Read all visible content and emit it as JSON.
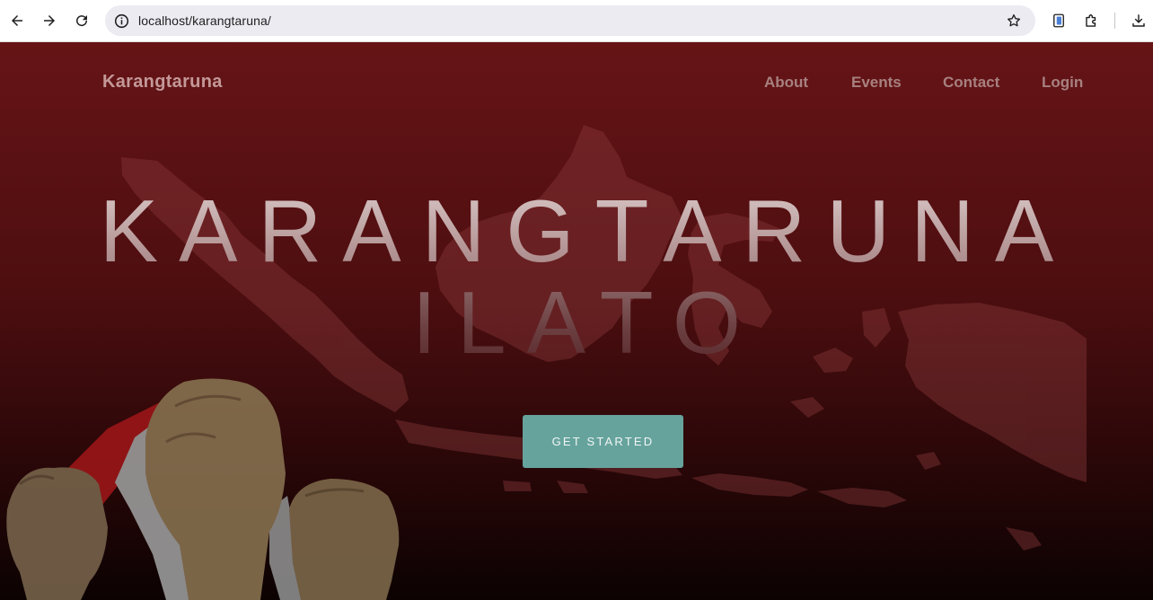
{
  "browser": {
    "url": "localhost/karangtaruna/",
    "icons": [
      "back-arrow-icon",
      "forward-arrow-icon",
      "reload-icon",
      "site-info-icon",
      "bookmark-star-icon",
      "tab-search-icon",
      "extensions-puzzle-icon",
      "download-icon"
    ]
  },
  "site": {
    "brand": "Karangtaruna",
    "menu": {
      "about": "About",
      "events": "Events",
      "contact": "Contact",
      "login": "Login"
    }
  },
  "hero": {
    "title_line1": "KARANGTARUNA",
    "title_line2": "ILATO",
    "cta_label": "GET STARTED",
    "colors": {
      "accent": "#66a39d",
      "background_top": "#661416",
      "background_bottom": "#0c0202"
    }
  }
}
